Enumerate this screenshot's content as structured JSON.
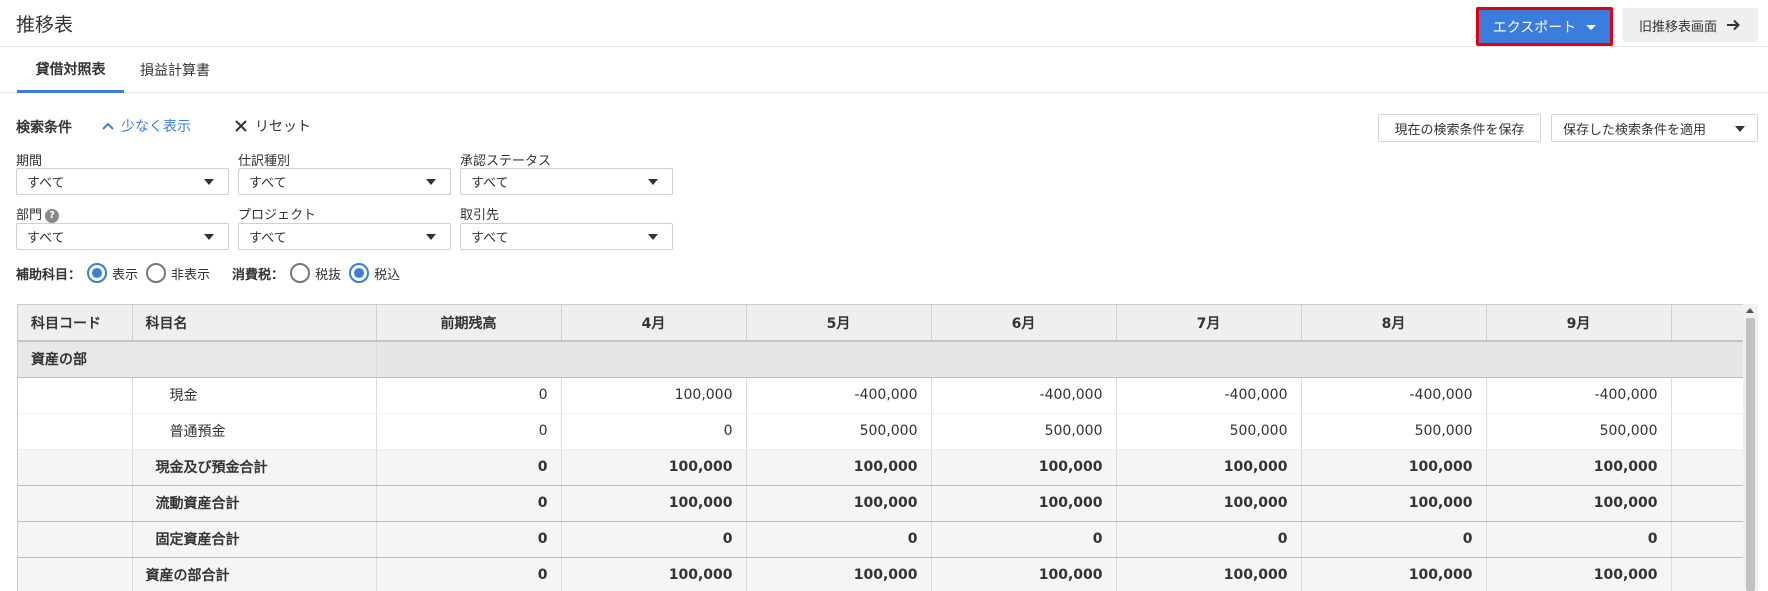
{
  "header": {
    "title": "推移表",
    "export_label": "エクスポート",
    "old_label": "旧推移表画面"
  },
  "tabs": [
    {
      "label": "貸借対照表",
      "active": true
    },
    {
      "label": "損益計算書",
      "active": false
    }
  ],
  "conditions": {
    "label": "検索条件",
    "less_label": "少なく表示",
    "reset_label": "リセット",
    "save_label": "現在の検索条件を保存",
    "apply_label": "保存した検索条件を適用",
    "fields": [
      {
        "label": "期間",
        "value": "すべて"
      },
      {
        "label": "仕訳種別",
        "value": "すべて"
      },
      {
        "label": "承認ステータス",
        "value": "すべて"
      },
      {
        "label": "部門",
        "value": "すべて",
        "help": "?"
      },
      {
        "label": "プロジェクト",
        "value": "すべて"
      },
      {
        "label": "取引先",
        "value": "すべて"
      }
    ],
    "sub_account": {
      "label": "補助科目：",
      "options": [
        "表示",
        "非表示"
      ],
      "selected": 0
    },
    "tax": {
      "label": "消費税：",
      "options": [
        "税抜",
        "税込"
      ],
      "selected": 1
    }
  },
  "table": {
    "headers": [
      "科目コード",
      "科目名",
      "前期残高",
      "4月",
      "5月",
      "6月",
      "7月",
      "8月",
      "9月",
      ""
    ],
    "rows": [
      {
        "kind": "section",
        "name": "資産の部",
        "values": []
      },
      {
        "kind": "plain",
        "indent": 1,
        "code": "",
        "name": "現金",
        "values": [
          "0",
          "100,000",
          "-400,000",
          "-400,000",
          "-400,000",
          "-400,000",
          "-400,000"
        ]
      },
      {
        "kind": "plain",
        "indent": 1,
        "code": "",
        "name": "普通預金",
        "values": [
          "0",
          "0",
          "500,000",
          "500,000",
          "500,000",
          "500,000",
          "500,000"
        ]
      },
      {
        "kind": "sub",
        "indent": 2,
        "code": "",
        "name": "現金及び預金合計",
        "values": [
          "0",
          "100,000",
          "100,000",
          "100,000",
          "100,000",
          "100,000",
          "100,000"
        ]
      },
      {
        "kind": "sub",
        "indent": 2,
        "code": "",
        "name": "流動資産合計",
        "values": [
          "0",
          "100,000",
          "100,000",
          "100,000",
          "100,000",
          "100,000",
          "100,000"
        ]
      },
      {
        "kind": "sub",
        "indent": 2,
        "code": "",
        "name": "固定資産合計",
        "values": [
          "0",
          "0",
          "0",
          "0",
          "0",
          "0",
          "0"
        ]
      },
      {
        "kind": "sub",
        "indent": 3,
        "code": "",
        "name": "資産の部合計",
        "values": [
          "0",
          "100,000",
          "100,000",
          "100,000",
          "100,000",
          "100,000",
          "100,000"
        ]
      }
    ]
  },
  "colors": {
    "accent": "#3b7ddd",
    "highlight": "#e00010"
  }
}
